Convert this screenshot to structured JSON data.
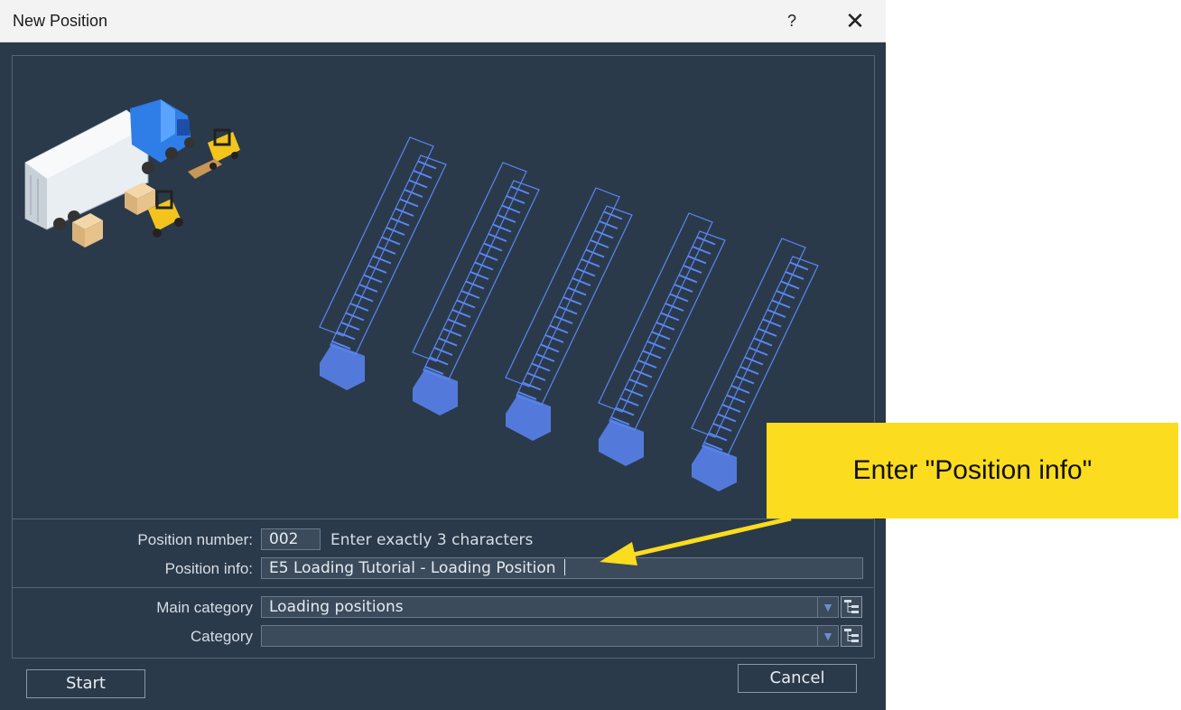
{
  "window": {
    "title": "New Position",
    "help_label": "?",
    "close_label": "✕"
  },
  "form": {
    "position_number": {
      "label": "Position number:",
      "value": "002",
      "hint": "Enter exactly 3 characters"
    },
    "position_info": {
      "label": "Position info:",
      "value": "E5 Loading Tutorial - Loading Position "
    },
    "main_category": {
      "label": "Main category",
      "value": "Loading positions"
    },
    "category": {
      "label": "Category",
      "value": ""
    }
  },
  "icons": {
    "dropdown": "down-arrow-icon",
    "tree": "tree-list-icon",
    "truck": "truck-forklift-illustration",
    "trailer": "trailer-wireframe"
  },
  "buttons": {
    "start": "Start",
    "cancel": "Cancel"
  },
  "annotation": {
    "callout_text": "Enter \"Position info\""
  },
  "colors": {
    "dialog_bg": "#2b3a4a",
    "field_bg": "#3b4b5c",
    "wireframe": "#5b86f5",
    "callout": "#fbdc1e"
  }
}
